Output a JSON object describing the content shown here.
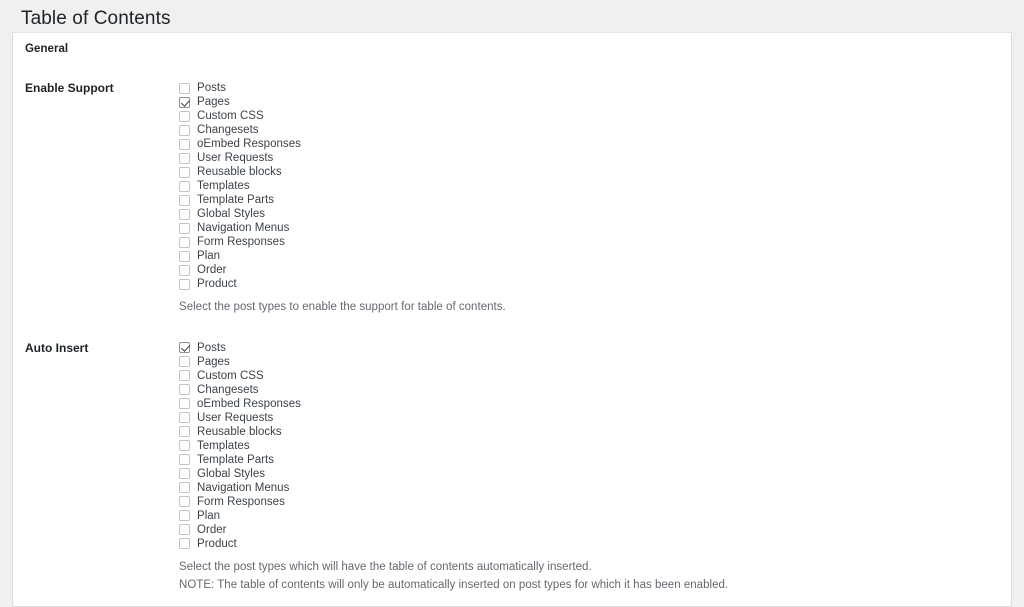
{
  "page": {
    "title": "Table of Contents"
  },
  "panel": {
    "section_title": "General"
  },
  "post_types": [
    "Posts",
    "Pages",
    "Custom CSS",
    "Changesets",
    "oEmbed Responses",
    "User Requests",
    "Reusable blocks",
    "Templates",
    "Template Parts",
    "Global Styles",
    "Navigation Menus",
    "Form Responses",
    "Plan",
    "Order",
    "Product"
  ],
  "rows": [
    {
      "label": "Enable Support",
      "checked": [
        "Pages"
      ],
      "descriptions": [
        "Select the post types to enable the support for table of contents."
      ]
    },
    {
      "label": "Auto Insert",
      "checked": [
        "Posts"
      ],
      "descriptions": [
        "Select the post types which will have the table of contents automatically inserted.",
        "NOTE: The table of contents will only be automatically inserted on post types for which it has been enabled."
      ]
    }
  ],
  "colors": {
    "page_bg": "#f0f0f1",
    "panel_bg": "#ffffff",
    "border": "#dcdcde",
    "text": "#3c434a",
    "heading": "#1d2327",
    "muted": "#646970"
  }
}
